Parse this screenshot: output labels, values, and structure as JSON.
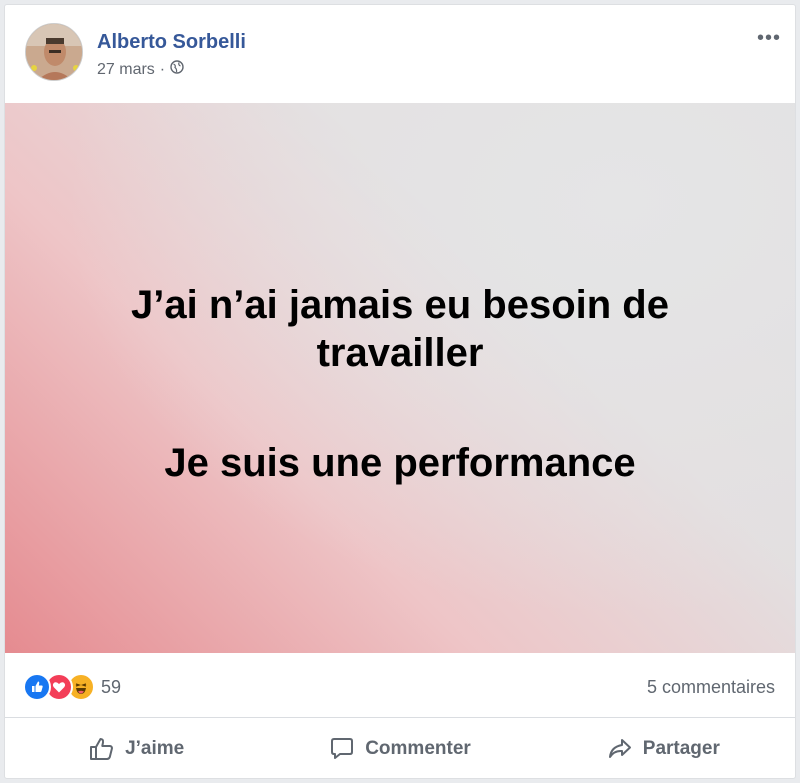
{
  "post": {
    "author": "Alberto Sorbelli",
    "date": "27 mars",
    "date_separator": "·",
    "privacy_icon": "globe-icon",
    "more_label": "•••",
    "text_line1": "J’ai n’ai jamais eu besoin de travailler",
    "text_line2": "Je suis une performance",
    "background_colors": [
      "#e58b90",
      "#eec5c7",
      "#dfdfe0"
    ]
  },
  "stats": {
    "reactions": [
      "like-icon",
      "love-icon",
      "haha-icon"
    ],
    "reaction_count": "59",
    "comments": "5 commentaires"
  },
  "actions": {
    "like": "J’aime",
    "comment": "Commenter",
    "share": "Partager"
  },
  "colors": {
    "author": "#365899",
    "muted": "#606770",
    "like": "#1877f2",
    "love": "#f33e58",
    "haha": "#f7b125"
  }
}
